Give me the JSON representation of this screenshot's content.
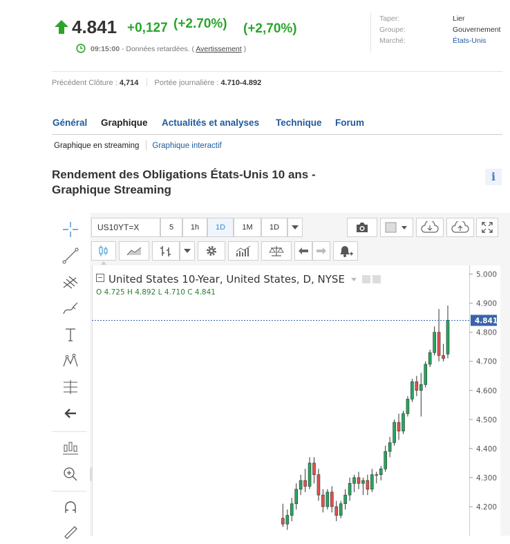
{
  "quote": {
    "price": "4.841",
    "change": "+0,127",
    "change_pct": "(+2.70%)",
    "change_pct_alt": "(+2,70%)",
    "time": "09:15:00",
    "delay_text": "- Données retardées. (",
    "warning_link": "Avertissement",
    "delay_close": ")",
    "up_color": "#2aa52a"
  },
  "info": [
    {
      "key": "Taper:",
      "value": "Lier"
    },
    {
      "key": "Groupe:",
      "value": "Gouvernement"
    },
    {
      "key": "Marché:",
      "value": "États-Unis"
    }
  ],
  "close_row": {
    "prev_label": "Précédent Clôture :",
    "prev_value": "4,714",
    "range_label": "Portée journalière :",
    "range_value": "4.710-4.892"
  },
  "tabs": [
    {
      "label": "Général",
      "active": false
    },
    {
      "label": "Graphique",
      "active": true
    },
    {
      "label": "Actualités et analyses",
      "active": false
    },
    {
      "label": "Technique",
      "active": false
    },
    {
      "label": "Forum",
      "active": false
    }
  ],
  "subtabs": [
    "Graphique en streaming",
    "Graphique interactif"
  ],
  "page_title": "Rendement des Obligations États-Unis 10 ans - Graphique Streaming",
  "info_button": "i",
  "chart_toolbar": {
    "symbol": "US10YT=X",
    "intervals": [
      "5",
      "1h",
      "1D",
      "1M",
      "1D"
    ],
    "selected_interval": "1D"
  },
  "chart_legend": {
    "title": "United States 10-Year, United States, D, NYSE",
    "ohlc": "O 4.725  H 4.892  L 4.710  C 4.841"
  },
  "chart_data": {
    "type": "candlestick",
    "y_ticks": [
      "5.000",
      "4.900",
      "4.800",
      "4.700",
      "4.600",
      "4.500",
      "4.400",
      "4.300",
      "4.200"
    ],
    "ylim": [
      4.1,
      5.03
    ],
    "last_price_label": "4.841",
    "last_price": 4.841,
    "up_color": "#26a65b",
    "down_color": "#e0524f",
    "candles": [
      {
        "o": 4.16,
        "h": 4.21,
        "l": 4.13,
        "c": 4.14
      },
      {
        "o": 4.14,
        "h": 4.19,
        "l": 4.12,
        "c": 4.17
      },
      {
        "o": 4.17,
        "h": 4.23,
        "l": 4.15,
        "c": 4.21
      },
      {
        "o": 4.21,
        "h": 4.28,
        "l": 4.19,
        "c": 4.26
      },
      {
        "o": 4.26,
        "h": 4.31,
        "l": 4.24,
        "c": 4.29
      },
      {
        "o": 4.29,
        "h": 4.33,
        "l": 4.25,
        "c": 4.27
      },
      {
        "o": 4.27,
        "h": 4.37,
        "l": 4.26,
        "c": 4.35
      },
      {
        "o": 4.35,
        "h": 4.37,
        "l": 4.28,
        "c": 4.31
      },
      {
        "o": 4.31,
        "h": 4.33,
        "l": 4.22,
        "c": 4.24
      },
      {
        "o": 4.24,
        "h": 4.26,
        "l": 4.18,
        "c": 4.2
      },
      {
        "o": 4.2,
        "h": 4.26,
        "l": 4.19,
        "c": 4.25
      },
      {
        "o": 4.25,
        "h": 4.27,
        "l": 4.18,
        "c": 4.2
      },
      {
        "o": 4.2,
        "h": 4.22,
        "l": 4.15,
        "c": 4.17
      },
      {
        "o": 4.17,
        "h": 4.22,
        "l": 4.16,
        "c": 4.21
      },
      {
        "o": 4.21,
        "h": 4.26,
        "l": 4.19,
        "c": 4.24
      },
      {
        "o": 4.24,
        "h": 4.3,
        "l": 4.22,
        "c": 4.28
      },
      {
        "o": 4.28,
        "h": 4.31,
        "l": 4.25,
        "c": 4.3
      },
      {
        "o": 4.3,
        "h": 4.32,
        "l": 4.26,
        "c": 4.28
      },
      {
        "o": 4.28,
        "h": 4.3,
        "l": 4.24,
        "c": 4.29
      },
      {
        "o": 4.29,
        "h": 4.31,
        "l": 4.24,
        "c": 4.26
      },
      {
        "o": 4.26,
        "h": 4.33,
        "l": 4.25,
        "c": 4.31
      },
      {
        "o": 4.31,
        "h": 4.32,
        "l": 4.28,
        "c": 4.31
      },
      {
        "o": 4.31,
        "h": 4.34,
        "l": 4.29,
        "c": 4.33
      },
      {
        "o": 4.33,
        "h": 4.41,
        "l": 4.32,
        "c": 4.39
      },
      {
        "o": 4.39,
        "h": 4.44,
        "l": 4.37,
        "c": 4.42
      },
      {
        "o": 4.42,
        "h": 4.5,
        "l": 4.41,
        "c": 4.49
      },
      {
        "o": 4.49,
        "h": 4.52,
        "l": 4.43,
        "c": 4.46
      },
      {
        "o": 4.46,
        "h": 4.53,
        "l": 4.45,
        "c": 4.52
      },
      {
        "o": 4.52,
        "h": 4.58,
        "l": 4.51,
        "c": 4.57
      },
      {
        "o": 4.57,
        "h": 4.64,
        "l": 4.56,
        "c": 4.63
      },
      {
        "o": 4.63,
        "h": 4.65,
        "l": 4.58,
        "c": 4.6
      },
      {
        "o": 4.6,
        "h": 4.66,
        "l": 4.51,
        "c": 4.62
      },
      {
        "o": 4.62,
        "h": 4.7,
        "l": 4.61,
        "c": 4.69
      },
      {
        "o": 4.69,
        "h": 4.74,
        "l": 4.68,
        "c": 4.73
      },
      {
        "o": 4.73,
        "h": 4.82,
        "l": 4.72,
        "c": 4.8
      },
      {
        "o": 4.8,
        "h": 4.88,
        "l": 4.7,
        "c": 4.72
      },
      {
        "o": 4.72,
        "h": 4.76,
        "l": 4.7,
        "c": 4.71
      },
      {
        "o": 4.725,
        "h": 4.892,
        "l": 4.71,
        "c": 4.841
      }
    ]
  }
}
